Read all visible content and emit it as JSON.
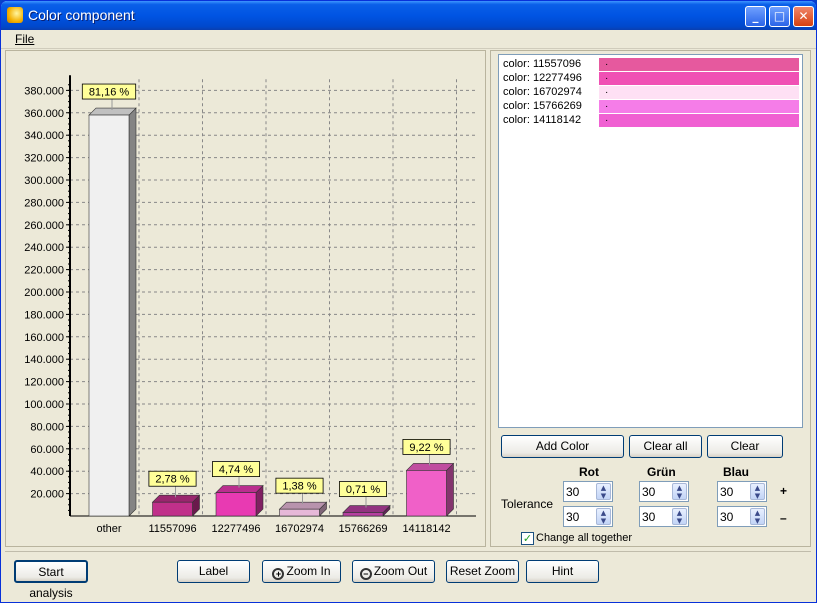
{
  "window": {
    "title": "Color component",
    "minimize": "_",
    "maximize": "□",
    "close": "✕"
  },
  "menu": {
    "file": "File"
  },
  "chart_data": {
    "type": "bar",
    "categories": [
      "other",
      "11557096",
      "12277496",
      "16702974",
      "15766269",
      "14118142"
    ],
    "values": [
      358000,
      12300,
      20900,
      6100,
      3100,
      40700
    ],
    "data_labels": [
      "81,16 %",
      "2,78 %",
      "4,74 %",
      "1,38 %",
      "0,71 %",
      "9,22 %"
    ],
    "bar_colors": [
      "#f0f0f0",
      "#c0308a",
      "#e83ab2",
      "#e6b8d8",
      "#b640a0",
      "#f060c8"
    ],
    "yticks": [
      "20.000",
      "40.000",
      "60.000",
      "80.000",
      "100.000",
      "120.000",
      "140.000",
      "160.000",
      "180.000",
      "200.000",
      "220.000",
      "240.000",
      "260.000",
      "280.000",
      "300.000",
      "320.000",
      "340.000",
      "360.000",
      "380.000"
    ],
    "ylim": [
      0,
      390000
    ],
    "grid": true
  },
  "colors": [
    {
      "label": "color: 11557096",
      "swatch": "#e6599e",
      "mark": "·"
    },
    {
      "label": "color: 12277496",
      "swatch": "#f050b4",
      "mark": "·"
    },
    {
      "label": "color: 16702974",
      "swatch": "#fee0f4",
      "mark": "·"
    },
    {
      "label": "color: 15766269",
      "swatch": "#f57de8",
      "mark": "·"
    },
    {
      "label": "color: 14118142",
      "swatch": "#f060d2",
      "mark": "·"
    }
  ],
  "buttons": {
    "add_color": "Add Color",
    "clear_all": "Clear all",
    "clear": "Clear",
    "start_analysis": "Start analysis",
    "label": "Label",
    "zoom_in": "Zoom In",
    "zoom_out": "Zoom Out",
    "reset_zoom": "Reset Zoom",
    "hint": "Hint"
  },
  "tolerance": {
    "label": "Tolerance",
    "headers": {
      "rot": "Rot",
      "gruen": "Grün",
      "blau": "Blau"
    },
    "plus": "+",
    "minus": "–",
    "row1": {
      "rot": "30",
      "gruen": "30",
      "blau": "30"
    },
    "row2": {
      "rot": "30",
      "gruen": "30",
      "blau": "30"
    },
    "change_all": "Change all together",
    "change_all_checked": true
  },
  "icons": {
    "zoom_in": "+",
    "zoom_out": "−",
    "check": "✓",
    "up": "▲",
    "down": "▼"
  }
}
